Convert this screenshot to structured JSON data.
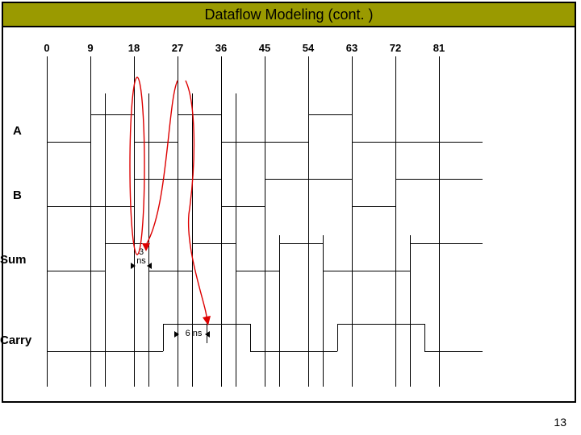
{
  "slide": {
    "title": "Dataflow Modeling (cont. )",
    "page_number": "13"
  },
  "timing": {
    "ticks": [
      "0",
      "9",
      "18",
      "27",
      "36",
      "45",
      "54",
      "63",
      "72",
      "81"
    ],
    "signals": [
      "A",
      "B",
      "Sum",
      "Carry"
    ],
    "annotations": {
      "sum_delay": "3\nns",
      "carry_delay": "6 ns"
    },
    "chart_data": {
      "type": "timing-diagram",
      "time_unit": "ns",
      "time_range": [
        0,
        90
      ],
      "grid_interval": 9,
      "colors": {
        "arrow": "#d00"
      },
      "signals": [
        {
          "name": "A",
          "transitions": [
            9,
            18,
            27,
            36,
            54,
            63
          ]
        },
        {
          "name": "B",
          "transitions": [
            18,
            36,
            45,
            63,
            72
          ]
        },
        {
          "name": "Sum",
          "transitions": [
            12,
            21,
            30,
            39,
            48,
            57,
            75
          ],
          "delay_ns": 3
        },
        {
          "name": "Carry",
          "transitions": [
            24,
            42,
            60,
            78
          ],
          "delay_ns": 6
        }
      ],
      "arrows": [
        {
          "from_signal": "A",
          "from_time": 18,
          "to_signal": "Sum",
          "to_time": 21,
          "label": "3 ns"
        },
        {
          "from_signal": "A",
          "from_time": 27,
          "to_signal": "Sum",
          "to_time": 30,
          "label": "3 ns"
        },
        {
          "from_signal": "A",
          "from_time": 27,
          "to_signal": "Carry",
          "to_time": 33,
          "label": "6 ns"
        }
      ]
    }
  }
}
